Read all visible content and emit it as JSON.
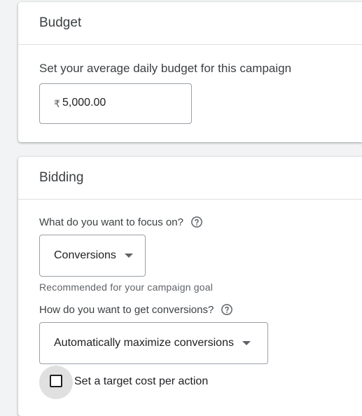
{
  "budget": {
    "title": "Budget",
    "description": "Set your average daily budget for this campaign",
    "currency_symbol": "₹",
    "amount": "5,000.00"
  },
  "bidding": {
    "title": "Bidding",
    "focus_question": "What do you want to focus on?",
    "focus_help_icon": "help-circle-icon",
    "focus_value": "Conversions",
    "focus_hint": "Recommended for your campaign goal",
    "conversions_question": "How do you want to get conversions?",
    "conversions_help_icon": "help-circle-icon",
    "conversions_value": "Automatically maximize conversions",
    "target_cpa_label": "Set a target cost per action",
    "target_cpa_checked": false
  },
  "colors": {
    "background": "#f1f3f4",
    "card": "#ffffff",
    "text_primary": "#202124",
    "text_secondary": "#5f6368",
    "border": "#9aa0a6"
  }
}
